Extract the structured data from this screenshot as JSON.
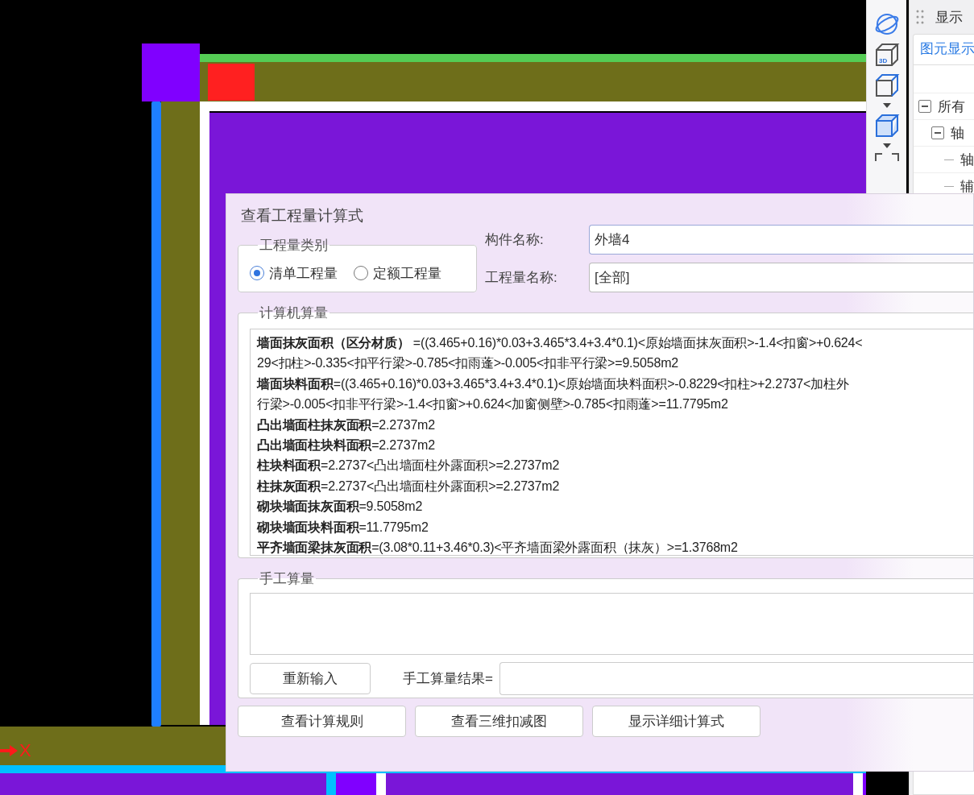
{
  "canvas": {
    "axis_label": "X"
  },
  "toolbar": {
    "cube_badge": "3D"
  },
  "side_panel": {
    "title": "显示",
    "tabs": [
      {
        "label": "图元显示",
        "selected": true
      }
    ],
    "tree": [
      {
        "label": "所有",
        "expanded": true,
        "children": [
          {
            "label": "轴",
            "expanded": true,
            "children": [
              {
                "label": "轴"
              },
              {
                "label": "辅"
              }
            ]
          }
        ]
      }
    ]
  },
  "dialog": {
    "title": "查看工程量计算式",
    "category": {
      "title": "工程量类别",
      "options": [
        {
          "label": "清单工程量",
          "selected": true
        },
        {
          "label": "定额工程量",
          "selected": false
        }
      ]
    },
    "fields": [
      {
        "label": "构件名称:",
        "value": "外墙4"
      },
      {
        "label": "工程量名称:",
        "value": "[全部]"
      }
    ],
    "computed": {
      "title": "计算机算量",
      "lines": [
        {
          "label": "墙面抹灰面积（区分材质）",
          "text": " =((3.465+0.16)*0.03+3.465*3.4+3.4*0.1)<原始墙面抹灰面积>-1.4<扣窗>+0.624<"
        },
        {
          "text": "29<扣柱>-0.335<扣平行梁>-0.785<扣雨蓬>-0.005<扣非平行梁>=9.5058m2"
        },
        {
          "label": "墙面块料面积",
          "text": "=((3.465+0.16)*0.03+3.465*3.4+3.4*0.1)<原始墙面块料面积>-0.8229<扣柱>+2.2737<加柱外"
        },
        {
          "text": "行梁>-0.005<扣非平行梁>-1.4<扣窗>+0.624<加窗侧壁>-0.785<扣雨蓬>=11.7795m2"
        },
        {
          "label": "凸出墙面柱抹灰面积",
          "text": "=2.2737m2"
        },
        {
          "label": "凸出墙面柱块料面积",
          "text": "=2.2737m2"
        },
        {
          "label": "柱块料面积",
          "text": "=2.2737<凸出墙面柱外露面积>=2.2737m2"
        },
        {
          "label": "柱抹灰面积",
          "text": "=2.2737<凸出墙面柱外露面积>=2.2737m2"
        },
        {
          "label": "砌块墙面抹灰面积",
          "text": "=9.5058m2"
        },
        {
          "label": "砌块墙面块料面积",
          "text": "=11.7795m2"
        },
        {
          "label": "平齐墙面梁抹灰面积",
          "text": "=(3.08*0.11+3.46*0.3)<平齐墙面梁外露面积（抹灰）>=1.3768m2"
        }
      ]
    },
    "manual": {
      "title": "手工算量",
      "reset_button": "重新输入",
      "result_label": "手工算量结果="
    },
    "buttons": [
      "查看计算规则",
      "查看三维扣减图",
      "显示详细计算式"
    ]
  }
}
